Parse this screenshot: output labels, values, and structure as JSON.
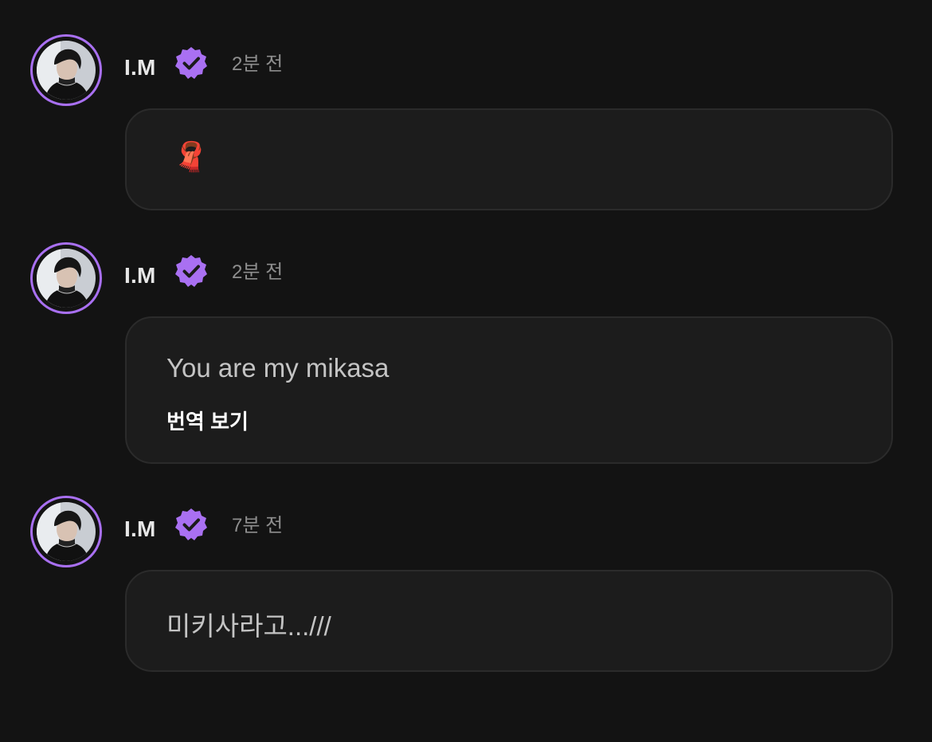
{
  "accent_color": "#a970f2",
  "posts": [
    {
      "author": "I.M",
      "verified": true,
      "time": "2분 전",
      "message": "🧣",
      "translate_label": ""
    },
    {
      "author": "I.M",
      "verified": true,
      "time": "2분 전",
      "message": "You are my mikasa",
      "translate_label": "번역 보기"
    },
    {
      "author": "I.M",
      "verified": true,
      "time": "7분 전",
      "message": "미키사라고...///",
      "translate_label": ""
    }
  ],
  "icons": {
    "avatar": "profile-photo",
    "verified": "verified-badge-icon",
    "message_1": "scarf-emoji"
  }
}
